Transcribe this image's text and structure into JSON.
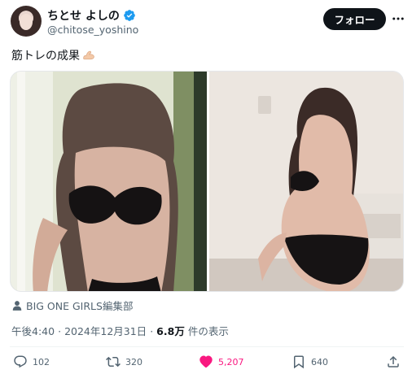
{
  "user": {
    "display_name": "ちとせ よしの",
    "handle": "@chitose_yoshino",
    "follow_label": "フォロー"
  },
  "tweet": {
    "text": "筋トレの成果",
    "emoji": "flexed-biceps-icon"
  },
  "media": {
    "source_label": "BIG ONE GIRLS編集部"
  },
  "meta": {
    "time": "午後4:40",
    "separator": "·",
    "date": "2024年12月31日",
    "separator2": "·",
    "views_count": "6.8万",
    "views_label": "件の表示"
  },
  "actions": {
    "replies": "102",
    "retweets": "320",
    "likes": "5,207",
    "bookmarks": "640"
  },
  "colors": {
    "like_active": "#f91880",
    "verified": "#1d9bf0",
    "follow_bg": "#0f1419",
    "secondary_text": "#536471"
  }
}
